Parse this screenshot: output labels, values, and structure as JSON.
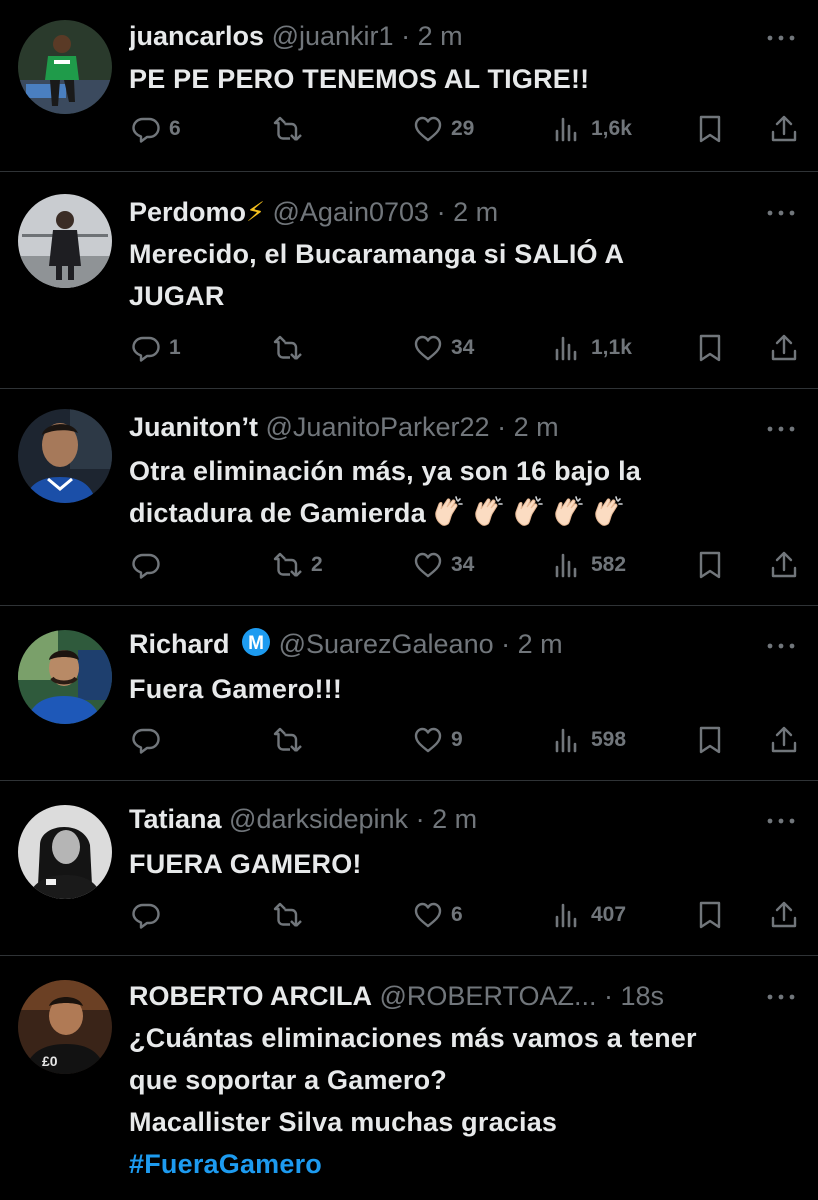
{
  "tweets": [
    {
      "name": "juancarlos",
      "name_suffix": "",
      "handle": "@juankir1",
      "dot": "·",
      "time": "2 m",
      "lines": [
        "PE PE PERO TENEMOS AL TIGRE!!"
      ],
      "replies": "6",
      "retweets": "",
      "likes": "29",
      "views": "1,6k",
      "avatar": "player-in-green-kit"
    },
    {
      "name": "Perdomo",
      "name_suffix": "⚡",
      "handle": "@Again0703",
      "dot": "·",
      "time": "2 m",
      "lines": [
        "Merecido, el Bucaramanga si SALIÓ A",
        "JUGAR"
      ],
      "replies": "1",
      "retweets": "",
      "likes": "34",
      "views": "1,1k",
      "avatar": "person-standing-indoor"
    },
    {
      "name": "Juaniton’t",
      "name_suffix": "",
      "handle": "@JuanitoParker22",
      "dot": "·",
      "time": "2 m",
      "lines": [
        "Otra eliminación más, ya son 16 bajo la",
        "dictadura de Gamierda"
      ],
      "claps": 5,
      "replies": "",
      "retweets": "2",
      "likes": "34",
      "views": "582",
      "avatar": "player-in-blue-kit"
    },
    {
      "name": "Richard",
      "name_suffix": "",
      "badge": "M",
      "handle": "@SuarezGaleano",
      "dot": "·",
      "time": "2 m",
      "lines": [
        "Fuera Gamero!!!"
      ],
      "replies": "",
      "retweets": "",
      "likes": "9",
      "views": "598",
      "avatar": "man-in-blue-shirt"
    },
    {
      "name": "Tatiana",
      "name_suffix": "",
      "handle": "@darksidepink",
      "dot": "·",
      "time": "2 m",
      "lines": [
        "FUERA GAMERO!"
      ],
      "replies": "",
      "retweets": "",
      "likes": "6",
      "views": "407",
      "avatar": "woman-black-and-white"
    },
    {
      "name": "ROBERTO ARCILA",
      "name_suffix": "",
      "handle": "@ROBERTOAZ...",
      "dot": "·",
      "time": "18s",
      "lines": [
        "¿Cuántas eliminaciones más vamos a tener",
        "que soportar a Gamero?",
        "Macallister Silva muchas gracias"
      ],
      "hashtag": "#FueraGamero",
      "avatar": "man-in-dark-jacket"
    }
  ],
  "colors": {
    "background": "#000000",
    "text": "#e7e9ea",
    "muted": "#71767b",
    "link": "#1d9bf0",
    "divider": "#2f3336",
    "badge": "#1d9bf0"
  },
  "icons": [
    "reply-icon",
    "retweet-icon",
    "like-icon",
    "views-icon",
    "bookmark-icon",
    "share-icon",
    "more-icon",
    "lightning-emoji",
    "clapping-hands-emoji"
  ]
}
